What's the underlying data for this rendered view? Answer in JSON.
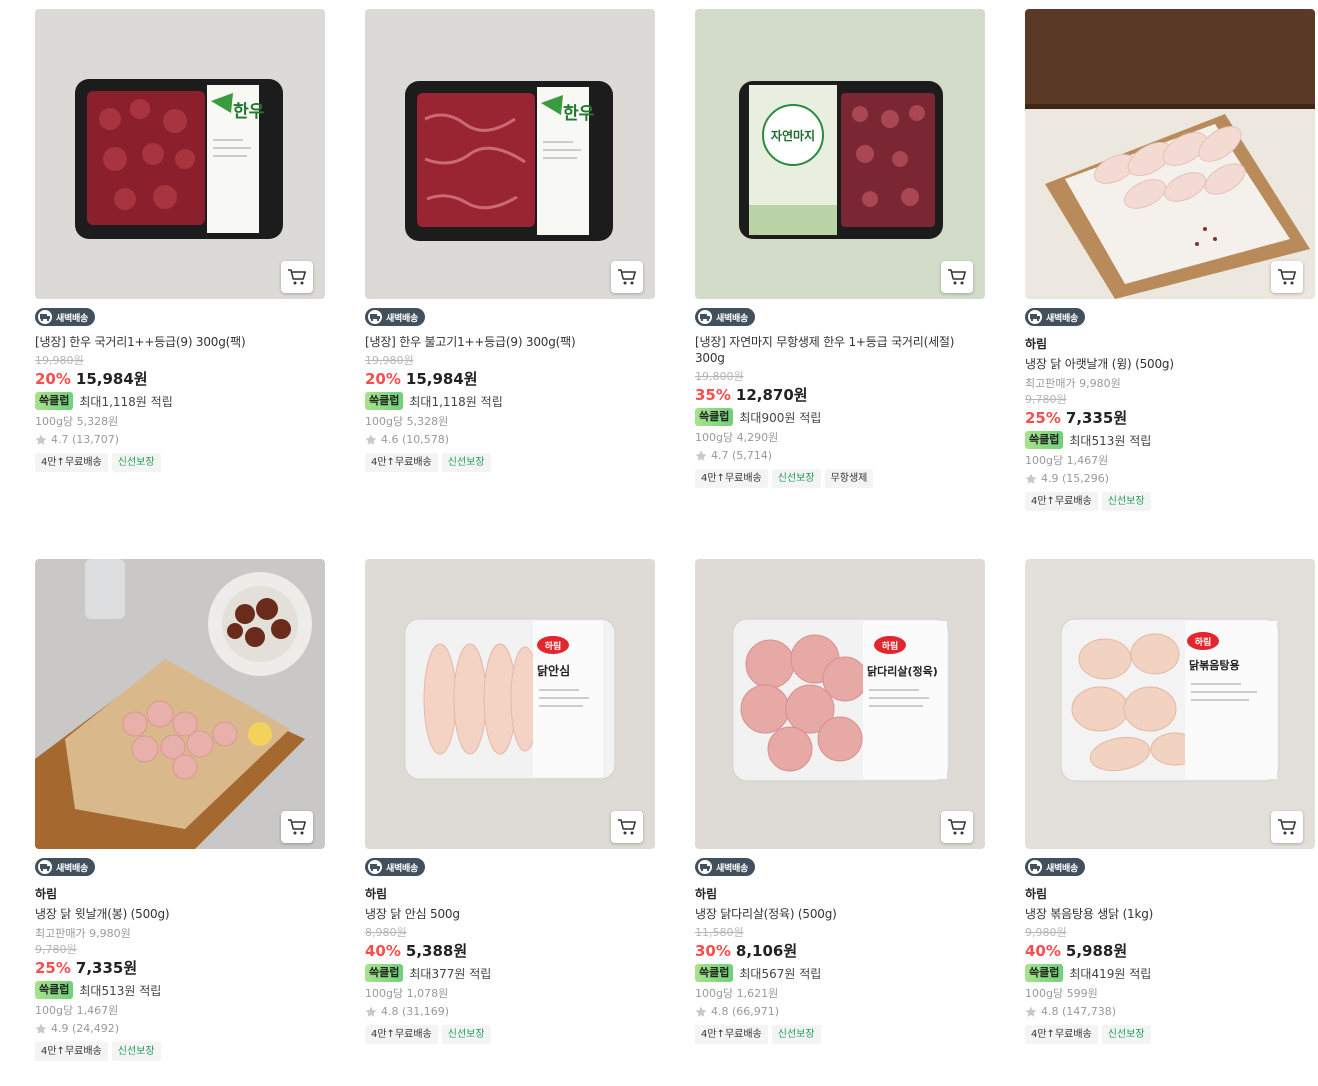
{
  "colors": {
    "discount": "#fa4d4d",
    "delivery_badge": "#42505e",
    "reward_badge": "#8fdc80",
    "fresh_tag": "#1f9e5a"
  },
  "delivery_label": "새벽배송",
  "reward_label": "쓱클럽",
  "products": [
    {
      "title": "[냉장] 한우 국거리1++등급(9) 300g(팩)",
      "original_price": "19,980원",
      "discount": "20%",
      "price": "15,984원",
      "reward": "최대1,118원 적립",
      "unit_price": "100g당 5,328원",
      "rating": "4.7 (13,707)",
      "tags": [
        "4만↑무료배송",
        "신선보장"
      ],
      "image": "hanwoo-soup-meat-package"
    },
    {
      "title": "[냉장] 한우 불고기1++등급(9) 300g(팩)",
      "original_price": "19,980원",
      "discount": "20%",
      "price": "15,984원",
      "reward": "최대1,118원 적립",
      "unit_price": "100g당 5,328원",
      "rating": "4.6 (10,578)",
      "tags": [
        "4만↑무료배송",
        "신선보장"
      ],
      "image": "hanwoo-bulgogi-package"
    },
    {
      "title": "[냉장] 자연마지 무항생제 한우 1+등급 국거리(세절) 300g",
      "original_price": "19,800원",
      "discount": "35%",
      "price": "12,870원",
      "reward": "최대900원 적립",
      "unit_price": "100g당 4,290원",
      "rating": "4.7 (5,714)",
      "tags": [
        "4만↑무료배송",
        "신선보장",
        "무항생제"
      ],
      "image": "jayeonmaji-hanwoo-package"
    },
    {
      "brand": "하림",
      "title": "냉장 닭 아랫날개 (윙) (500g)",
      "ref_price": "최고판매가 9,980원",
      "original_price": "9,780원",
      "discount": "25%",
      "price": "7,335원",
      "reward": "최대513원 적립",
      "unit_price": "100g당 1,467원",
      "rating": "4.9 (15,296)",
      "tags": [
        "4만↑무료배송",
        "신선보장"
      ],
      "image": "chicken-wings-on-board"
    },
    {
      "brand": "하림",
      "title": "냉장 닭 윗날개(봉) (500g)",
      "ref_price": "최고판매가 9,980원",
      "original_price": "9,780원",
      "discount": "25%",
      "price": "7,335원",
      "reward": "최대513원 적립",
      "unit_price": "100g당 1,467원",
      "rating": "4.9 (24,492)",
      "tags": [
        "4만↑무료배송",
        "신선보장"
      ],
      "image": "chicken-drumettes-on-board"
    },
    {
      "brand": "하림",
      "title": "냉장 닭 안심 500g",
      "original_price": "8,980원",
      "discount": "40%",
      "price": "5,388원",
      "reward": "최대377원 적립",
      "unit_price": "100g당 1,078원",
      "rating": "4.8 (31,169)",
      "tags": [
        "4만↑무료배송",
        "신선보장"
      ],
      "image": "chicken-tenderloin-package",
      "pack_label": "닭안심"
    },
    {
      "brand": "하림",
      "title": "냉장 닭다리살(정육) (500g)",
      "original_price": "11,580원",
      "discount": "30%",
      "price": "8,106원",
      "reward": "최대567원 적립",
      "unit_price": "100g당 1,621원",
      "rating": "4.8 (66,971)",
      "tags": [
        "4만↑무료배송",
        "신선보장"
      ],
      "image": "chicken-thigh-package",
      "pack_label": "닭다리살(정육)"
    },
    {
      "brand": "하림",
      "title": "냉장 볶음탕용 생닭 (1kg)",
      "original_price": "9,980원",
      "discount": "40%",
      "price": "5,988원",
      "reward": "최대419원 적립",
      "unit_price": "100g당 599원",
      "rating": "4.8 (147,738)",
      "tags": [
        "4만↑무료배송",
        "신선보장"
      ],
      "image": "chicken-stew-cut-package",
      "pack_label": "닭볶음탕용"
    }
  ],
  "pack_brand": "하림",
  "hanwoo_label": "한우",
  "jayeonmaji_label": "자연마지"
}
